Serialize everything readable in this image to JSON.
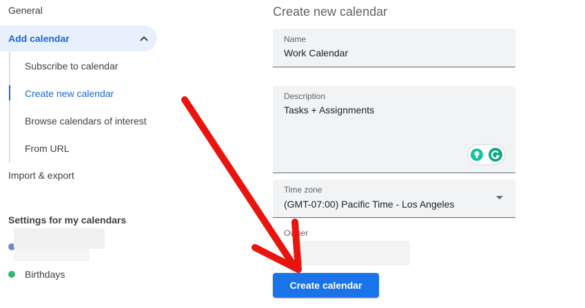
{
  "sidebar": {
    "general_label": "General",
    "add_calendar_label": "Add calendar",
    "sub_items": [
      {
        "label": "Subscribe to calendar"
      },
      {
        "label": "Create new calendar",
        "active": true
      },
      {
        "label": "Browse calendars of interest"
      },
      {
        "label": "From URL"
      }
    ],
    "import_export_label": "Import & export",
    "my_calendars_title": "Settings for my calendars",
    "my_calendars": [
      {
        "label": "",
        "color": "#7986cb",
        "redacted": true
      },
      {
        "label": "Birthdays",
        "color": "#33b679"
      }
    ]
  },
  "form": {
    "title": "Create new calendar",
    "name": {
      "label": "Name",
      "value": "Work Calendar"
    },
    "description": {
      "label": "Description",
      "value": "Tasks + Assignments"
    },
    "timezone": {
      "label": "Time zone",
      "value": "(GMT-07:00) Pacific Time - Los Angeles"
    },
    "owner": {
      "label": "Owner",
      "value": ""
    },
    "submit_label": "Create calendar"
  },
  "colors": {
    "accent": "#1a73e8",
    "active_text": "#1967d2",
    "active_bg": "#e8f0fe",
    "field_bg": "#f1f3f4",
    "annotation_arrow": "#e8150f",
    "grammarly_green": "#15c39a"
  },
  "icons": {
    "chevron": "chevron-up-icon",
    "dropdown": "dropdown-arrow-icon",
    "grammarly": "grammarly-icon",
    "suggestion": "lightbulb-icon"
  }
}
